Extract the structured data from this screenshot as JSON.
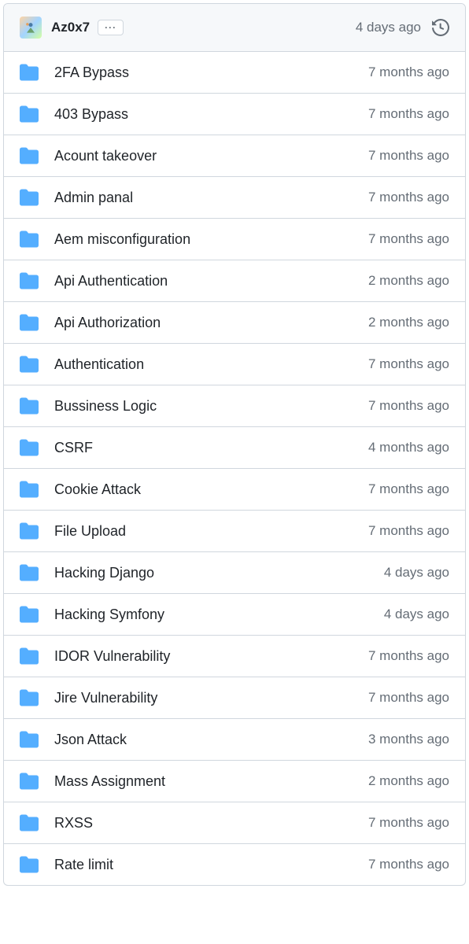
{
  "header": {
    "username": "Az0x7",
    "more_label": "···",
    "time": "4 days ago"
  },
  "files": [
    {
      "name": "2FA Bypass",
      "time": "7 months ago"
    },
    {
      "name": "403 Bypass",
      "time": "7 months ago"
    },
    {
      "name": "Acount takeover",
      "time": "7 months ago"
    },
    {
      "name": "Admin panal",
      "time": "7 months ago"
    },
    {
      "name": "Aem misconfiguration",
      "time": "7 months ago"
    },
    {
      "name": "Api Authentication",
      "time": "2 months ago"
    },
    {
      "name": "Api Authorization",
      "time": "2 months ago"
    },
    {
      "name": "Authentication",
      "time": "7 months ago"
    },
    {
      "name": "Bussiness Logic",
      "time": "7 months ago"
    },
    {
      "name": "CSRF",
      "time": "4 months ago"
    },
    {
      "name": "Cookie Attack",
      "time": "7 months ago"
    },
    {
      "name": "File Upload",
      "time": "7 months ago"
    },
    {
      "name": "Hacking Django",
      "time": "4 days ago"
    },
    {
      "name": "Hacking Symfony",
      "time": "4 days ago"
    },
    {
      "name": "IDOR Vulnerability",
      "time": "7 months ago"
    },
    {
      "name": "Jire Vulnerability",
      "time": "7 months ago"
    },
    {
      "name": "Json Attack",
      "time": "3 months ago"
    },
    {
      "name": "Mass Assignment",
      "time": "2 months ago"
    },
    {
      "name": "RXSS",
      "time": "7 months ago"
    },
    {
      "name": "Rate limit",
      "time": "7 months ago"
    }
  ]
}
